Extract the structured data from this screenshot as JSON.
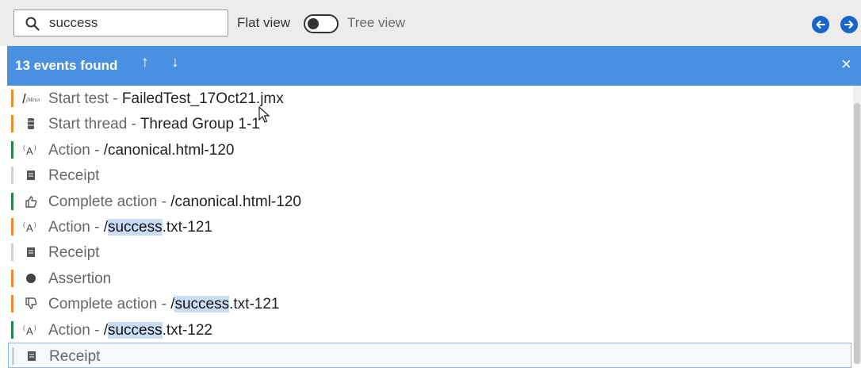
{
  "toolbar": {
    "search_value": "success",
    "flat_view_label": "Flat view",
    "tree_view_label": "Tree view",
    "view_mode": "flat"
  },
  "banner": {
    "count_label": "13 events found",
    "up_arrow": "↑",
    "down_arrow": "↓",
    "close": "×"
  },
  "colors": {
    "banner": "#4a90e2",
    "nav_button": "#1765c9",
    "orange": "#f08a24",
    "green": "#1e8a4a",
    "gray": "#cfcfcf",
    "highlight": "#c9dcf3"
  },
  "events": [
    {
      "icon": "jmeter-logo-icon",
      "type": "Start test",
      "sep": " - ",
      "detail": "FailedTest_17Oct21.jmx",
      "highlight": "",
      "rest": "",
      "bar": "orange"
    },
    {
      "icon": "thread-icon",
      "type": "Start thread",
      "sep": " - ",
      "detail": "Thread Group 1-1",
      "highlight": "",
      "rest": "",
      "bar": "orange"
    },
    {
      "icon": "action-icon",
      "type": "Action",
      "sep": " - ",
      "detail": "/canonical.html-120",
      "highlight": "",
      "rest": "",
      "bar": "green"
    },
    {
      "icon": "receipt-icon",
      "type": "Receipt",
      "sep": "",
      "detail": "",
      "highlight": "",
      "rest": "",
      "bar": "gray"
    },
    {
      "icon": "thumbs-up-icon",
      "type": "Complete action",
      "sep": " - ",
      "detail": "/canonical.html-120",
      "highlight": "",
      "rest": "",
      "bar": "green"
    },
    {
      "icon": "action-icon",
      "type": "Action",
      "sep": " - ",
      "detail": "/",
      "highlight": "success",
      "rest": ".txt-121",
      "bar": "orange"
    },
    {
      "icon": "receipt-icon",
      "type": "Receipt",
      "sep": "",
      "detail": "",
      "highlight": "",
      "rest": "",
      "bar": "gray"
    },
    {
      "icon": "assertion-icon",
      "type": "Assertion",
      "sep": "",
      "detail": "",
      "highlight": "",
      "rest": "",
      "bar": "orange"
    },
    {
      "icon": "thumbs-down-icon",
      "type": "Complete action",
      "sep": " - ",
      "detail": "/",
      "highlight": "success",
      "rest": ".txt-121",
      "bar": "orange"
    },
    {
      "icon": "action-icon",
      "type": "Action",
      "sep": " - ",
      "detail": "/",
      "highlight": "success",
      "rest": ".txt-122",
      "bar": "green"
    },
    {
      "icon": "receipt-icon",
      "type": "Receipt",
      "sep": "",
      "detail": "",
      "highlight": "",
      "rest": "",
      "bar": "gray",
      "selected": true
    }
  ]
}
